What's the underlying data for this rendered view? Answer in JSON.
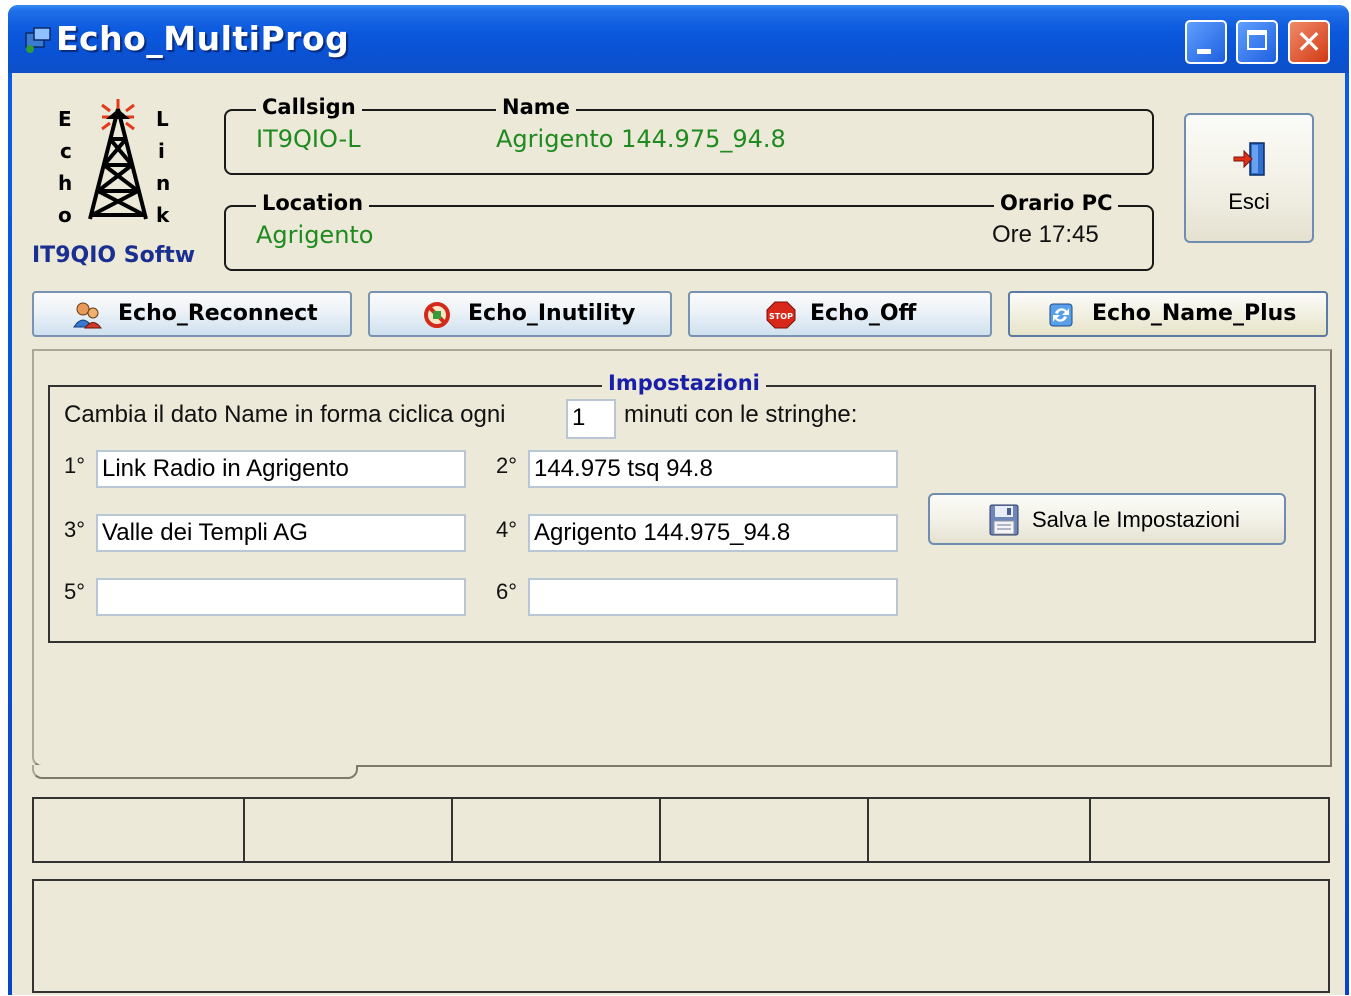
{
  "window": {
    "title": "Echo_MultiProg",
    "colors": {
      "titlebar": "#0a52d4",
      "background": "#ece9d8",
      "value_green": "#1f8a1f",
      "title_blue": "#1a1fa8"
    }
  },
  "logo": {
    "letters_left": [
      "E",
      "c",
      "h",
      "o"
    ],
    "letters_right": [
      "L",
      "i",
      "n",
      "k"
    ],
    "caption": "IT9QIO Softw",
    "icon": "radio-tower-icon"
  },
  "info": {
    "callsign": {
      "label": "Callsign",
      "value": "IT9QIO-L"
    },
    "name": {
      "label": "Name",
      "value": "Agrigento 144.975_94.8"
    },
    "location": {
      "label": "Location",
      "value": "Agrigento"
    },
    "orario": {
      "label": "Orario PC",
      "value": "Ore 17:45"
    }
  },
  "buttons": {
    "exit": {
      "label": "Esci",
      "icon": "exit-door-icon"
    }
  },
  "tabs": [
    {
      "label": "Echo_Reconnect",
      "icon": "users-icon",
      "active": false
    },
    {
      "label": "Echo_Inutility",
      "icon": "no-sign-icon",
      "active": false
    },
    {
      "label": "Echo_Off",
      "icon": "stop-icon",
      "active": false
    },
    {
      "label": "Echo_Name_Plus",
      "icon": "refresh-icon",
      "active": true
    }
  ],
  "settings": {
    "title": "Impostazioni",
    "prefix_text": "Cambia il dato Name in forma ciclica ogni",
    "interval_value": "1",
    "suffix_text": "minuti con le stringhe:",
    "strings": [
      {
        "label": "1°",
        "value": "Link Radio in Agrigento"
      },
      {
        "label": "2°",
        "value": "144.975 tsq 94.8"
      },
      {
        "label": "3°",
        "value": "Valle dei Templi AG"
      },
      {
        "label": "4°",
        "value": "Agrigento 144.975_94.8"
      },
      {
        "label": "5°",
        "value": ""
      },
      {
        "label": "6°",
        "value": ""
      }
    ],
    "save_button": {
      "label": "Salva le Impostazioni",
      "icon": "floppy-disk-icon"
    }
  },
  "statusbar": {
    "cells": [
      "",
      "",
      "",
      "",
      "",
      ""
    ]
  },
  "log": {
    "text": ""
  }
}
